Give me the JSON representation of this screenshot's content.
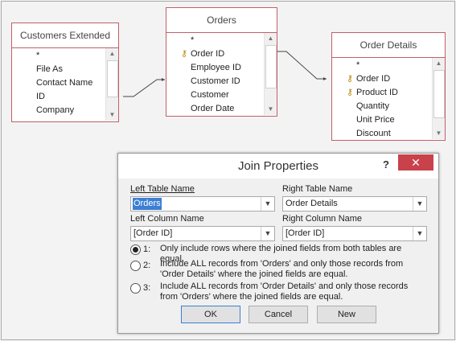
{
  "tables": {
    "customers": {
      "title": "Customers Extended",
      "fields": [
        "*",
        "File As",
        "Contact Name",
        "ID",
        "Company"
      ]
    },
    "orders": {
      "title": "Orders",
      "fields": [
        "*",
        "Order ID",
        "Employee ID",
        "Customer ID",
        "Customer",
        "Order Date"
      ],
      "keys": [
        "Order ID"
      ]
    },
    "order_details": {
      "title": "Order Details",
      "fields": [
        "*",
        "Order ID",
        "Product ID",
        "Quantity",
        "Unit Price",
        "Discount"
      ],
      "keys": [
        "Order ID",
        "Product ID"
      ]
    }
  },
  "dialog": {
    "title": "Join Properties",
    "help_glyph": "?",
    "close_glyph": "✕",
    "left_table_label": "Left Table Name",
    "right_table_label": "Right Table Name",
    "left_table_value": "Orders",
    "right_table_value": "Order Details",
    "left_column_label": "Left Column Name",
    "right_column_label": "Right Column Name",
    "left_column_value": "[Order ID]",
    "right_column_value": "[Order ID]",
    "options": [
      {
        "num": "1:",
        "text": "Only include rows where the joined fields from both tables are equal.",
        "selected": true
      },
      {
        "num": "2:",
        "text": "Include ALL records from 'Orders' and only those records from 'Order Details' where the joined fields are equal.",
        "selected": false
      },
      {
        "num": "3:",
        "text": "Include ALL records from 'Order Details' and only those records from 'Orders' where the joined fields are equal.",
        "selected": false
      }
    ],
    "ok_label": "OK",
    "cancel_label": "Cancel",
    "new_label": "New"
  },
  "colors": {
    "table_border": "#c0606a",
    "close_button": "#c9414b",
    "selection": "#3c7fd4"
  }
}
